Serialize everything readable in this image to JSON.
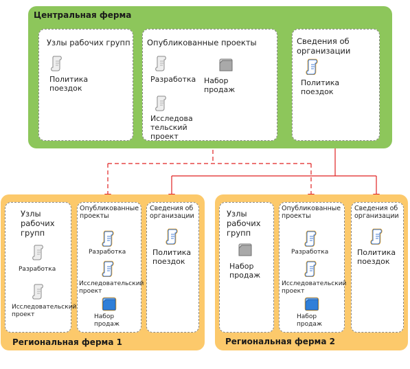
{
  "central_farm": {
    "title": "Центральная ферма",
    "workgroup_nodes": {
      "title": "Узлы рабочих групп",
      "items": [
        "Политика поездок"
      ]
    },
    "published_projects": {
      "title": "Опубликованные проекты",
      "items": [
        "Разработка",
        "Набор продаж",
        "Исследова тельский проект"
      ]
    },
    "org_info": {
      "title": "Сведения об организации",
      "items": [
        "Политика поездок"
      ]
    }
  },
  "regional_farm_1": {
    "title": "Региональная ферма 1",
    "workgroup_nodes": {
      "title": "Узлы рабочих групп",
      "items": [
        "Разработка",
        "Исследовательский проект"
      ]
    },
    "published_projects": {
      "title": "Опубликованные проекты",
      "items": [
        "Разработка",
        "Исследовательский проект",
        "Набор продаж"
      ]
    },
    "org_info": {
      "title": "Сведения об организации",
      "items": [
        "Политика поездок"
      ]
    }
  },
  "regional_farm_2": {
    "title": "Региональная ферма 2",
    "workgroup_nodes": {
      "title": "Узлы рабочих групп",
      "items": [
        "Набор продаж"
      ]
    },
    "published_projects": {
      "title": "Опубликованные проекты",
      "items": [
        "Разработка",
        "Исследовательский проект",
        "Набор продаж"
      ]
    },
    "org_info": {
      "title": "Сведения об организации",
      "items": [
        "Политика поездок"
      ]
    }
  },
  "colors": {
    "central": "#8dc65b",
    "regional": "#fcc96b",
    "connector": "#e02020",
    "doc_gray": "#9a9a9a",
    "doc_blue": "#2f7fd8",
    "doc_outline_orange": "#f3a51a"
  }
}
